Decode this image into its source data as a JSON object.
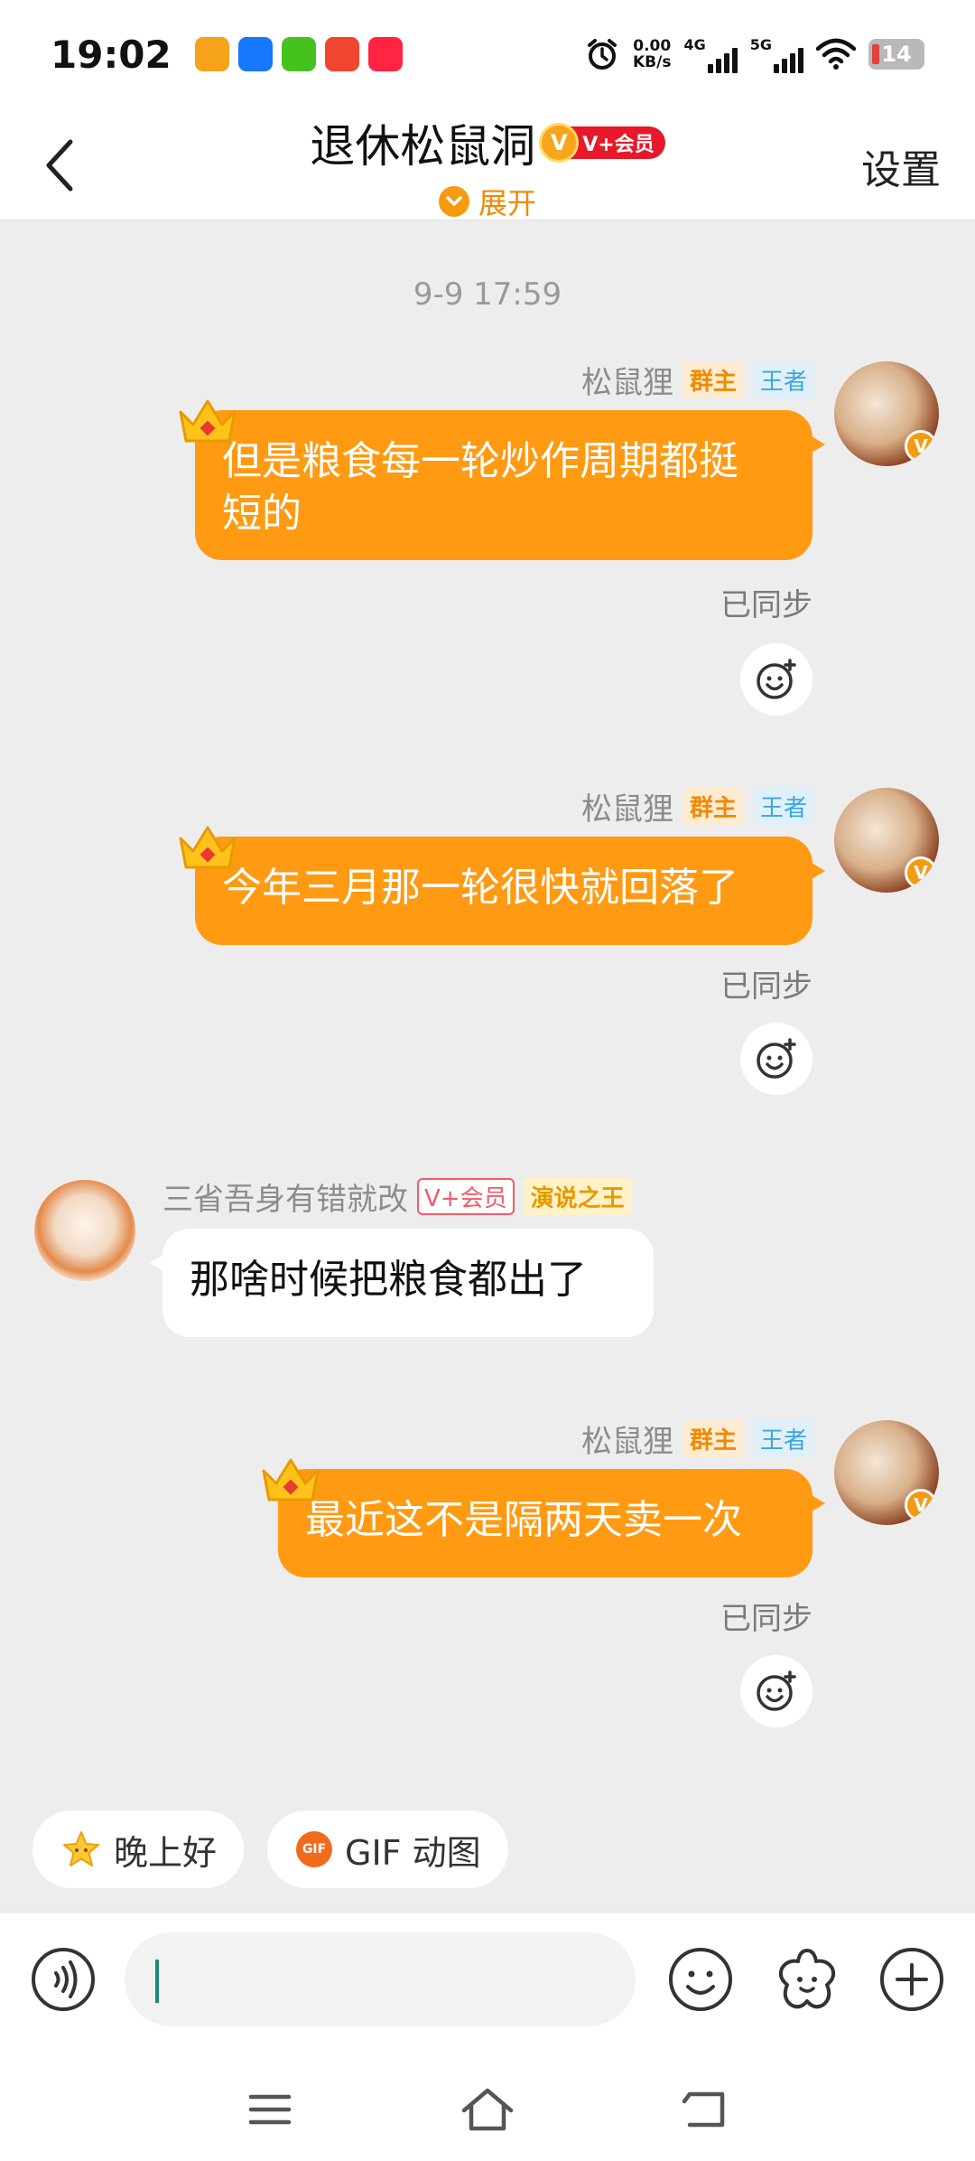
{
  "status_bar": {
    "time": "19:02",
    "net_speed_value": "0.00",
    "net_speed_unit": "KB/s",
    "sim1_label": "4G",
    "sim2_label": "5G",
    "battery": "14"
  },
  "header": {
    "title": "退休松鼠洞",
    "vip_badge": "V+会员",
    "vip_coin": "V",
    "expand_label": "展开",
    "settings_label": "设置"
  },
  "chat": {
    "timestamp": "9-9 17:59",
    "messages": [
      {
        "sender": "松鼠狸",
        "tag_owner": "群主",
        "tag_king": "王者",
        "text_line1": "但是粮食每一轮炒作周期都挺",
        "text_line2": "短的",
        "status": "已同步"
      },
      {
        "sender": "松鼠狸",
        "tag_owner": "群主",
        "tag_king": "王者",
        "text": "今年三月那一轮很快就回落了",
        "status": "已同步"
      },
      {
        "sender": "三省吾身有错就改",
        "tag_vip": "V+会员",
        "tag_title": "演说之王",
        "text": "那啥时候把粮食都出了"
      },
      {
        "sender": "松鼠狸",
        "tag_owner": "群主",
        "tag_king": "王者",
        "text": "最近这不是隔两天卖一次",
        "status": "已同步"
      }
    ],
    "avatar_vmark": "V"
  },
  "quick_replies": [
    {
      "label": "晚上好",
      "icon": "star-icon"
    },
    {
      "label": "GIF 动图",
      "icon": "gif-icon",
      "icon_text": "GIF"
    }
  ],
  "input": {
    "value": "",
    "icons": [
      "voice-icon",
      "emoji-icon",
      "sticker-icon",
      "plus-icon"
    ]
  },
  "nav": {
    "icons": [
      "menu-icon",
      "home-icon",
      "back-icon"
    ]
  },
  "colors": {
    "accent": "#ff9a12",
    "background": "#ededed",
    "bubble_other": "#ffffff"
  }
}
